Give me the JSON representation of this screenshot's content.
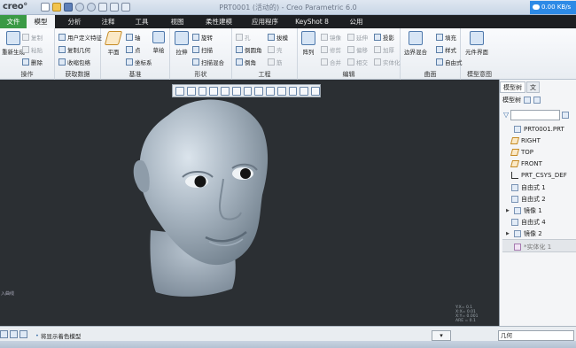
{
  "app": {
    "logo": "creo°",
    "title": "PRT0001 (活动的) - Creo Parametric 6.0",
    "network": "0.00 KB/s"
  },
  "tabs": [
    "文件",
    "模型",
    "分析",
    "注释",
    "工具",
    "视图",
    "柔性建模",
    "应用程序",
    "KeyShot 8",
    "公用"
  ],
  "ribbon": {
    "operations": {
      "label": "操作",
      "items": [
        "重新生成",
        "复制",
        "粘贴",
        "删除"
      ]
    },
    "get_data": {
      "label": "获取数据",
      "items": [
        "用户定义特征",
        "复制几何",
        "收缩包络"
      ]
    },
    "datum": {
      "label": "基准",
      "items": [
        "平面",
        "轴",
        "点",
        "坐标系",
        "草绘"
      ]
    },
    "shapes": {
      "label": "形状",
      "items": [
        "拉伸",
        "旋转",
        "扫描",
        "扫描混合"
      ]
    },
    "engineering": {
      "label": "工程",
      "items": [
        "孔",
        "倒圆角",
        "倒角",
        "拔模",
        "壳",
        "筋"
      ]
    },
    "editing": {
      "label": "编辑",
      "items": [
        "阵列",
        "镜像",
        "修剪",
        "合并",
        "延伸",
        "偏移",
        "相交",
        "投影",
        "加厚",
        "实体化"
      ]
    },
    "surfaces": {
      "label": "曲面",
      "items": [
        "边界混合",
        "填充",
        "样式",
        "自由式"
      ]
    },
    "model_intent": {
      "label": "模型意图",
      "items": [
        "元件界面"
      ]
    }
  },
  "panel": {
    "tabs": [
      "模型树",
      "文"
    ],
    "tree_label": "模型树",
    "items": [
      {
        "label": "PRT0001.PRT",
        "type": "part",
        "expandable": false
      },
      {
        "label": "RIGHT",
        "type": "plane",
        "expandable": false
      },
      {
        "label": "TOP",
        "type": "plane",
        "expandable": false
      },
      {
        "label": "FRONT",
        "type": "plane",
        "expandable": false
      },
      {
        "label": "PRT_CSYS_DEF",
        "type": "csys",
        "expandable": false
      },
      {
        "label": "自由式 1",
        "type": "feature",
        "expandable": false
      },
      {
        "label": "自由式 2",
        "type": "feature",
        "expandable": false
      },
      {
        "label": "镜像 1",
        "type": "feature",
        "expandable": true
      },
      {
        "label": "自由式 4",
        "type": "feature",
        "expandable": false
      },
      {
        "label": "镜像 2",
        "type": "feature",
        "expandable": true
      },
      {
        "label": "*实体化 1",
        "type": "feature-dim",
        "expandable": false
      }
    ]
  },
  "canvas": {
    "side_hint": "入曲线",
    "axes": [
      "Y:X= 0.1",
      "X:X= 0.01",
      "X:Y= 0.001",
      "ARE = 0.1"
    ]
  },
  "status": {
    "message": "将显示着色模型",
    "filter_value": "几何"
  },
  "colors": {
    "accent_green": "#3a9a45",
    "tab_bar": "#1d1f22",
    "viewport": "#2b2f33",
    "network_blue": "#2d8ae6"
  }
}
